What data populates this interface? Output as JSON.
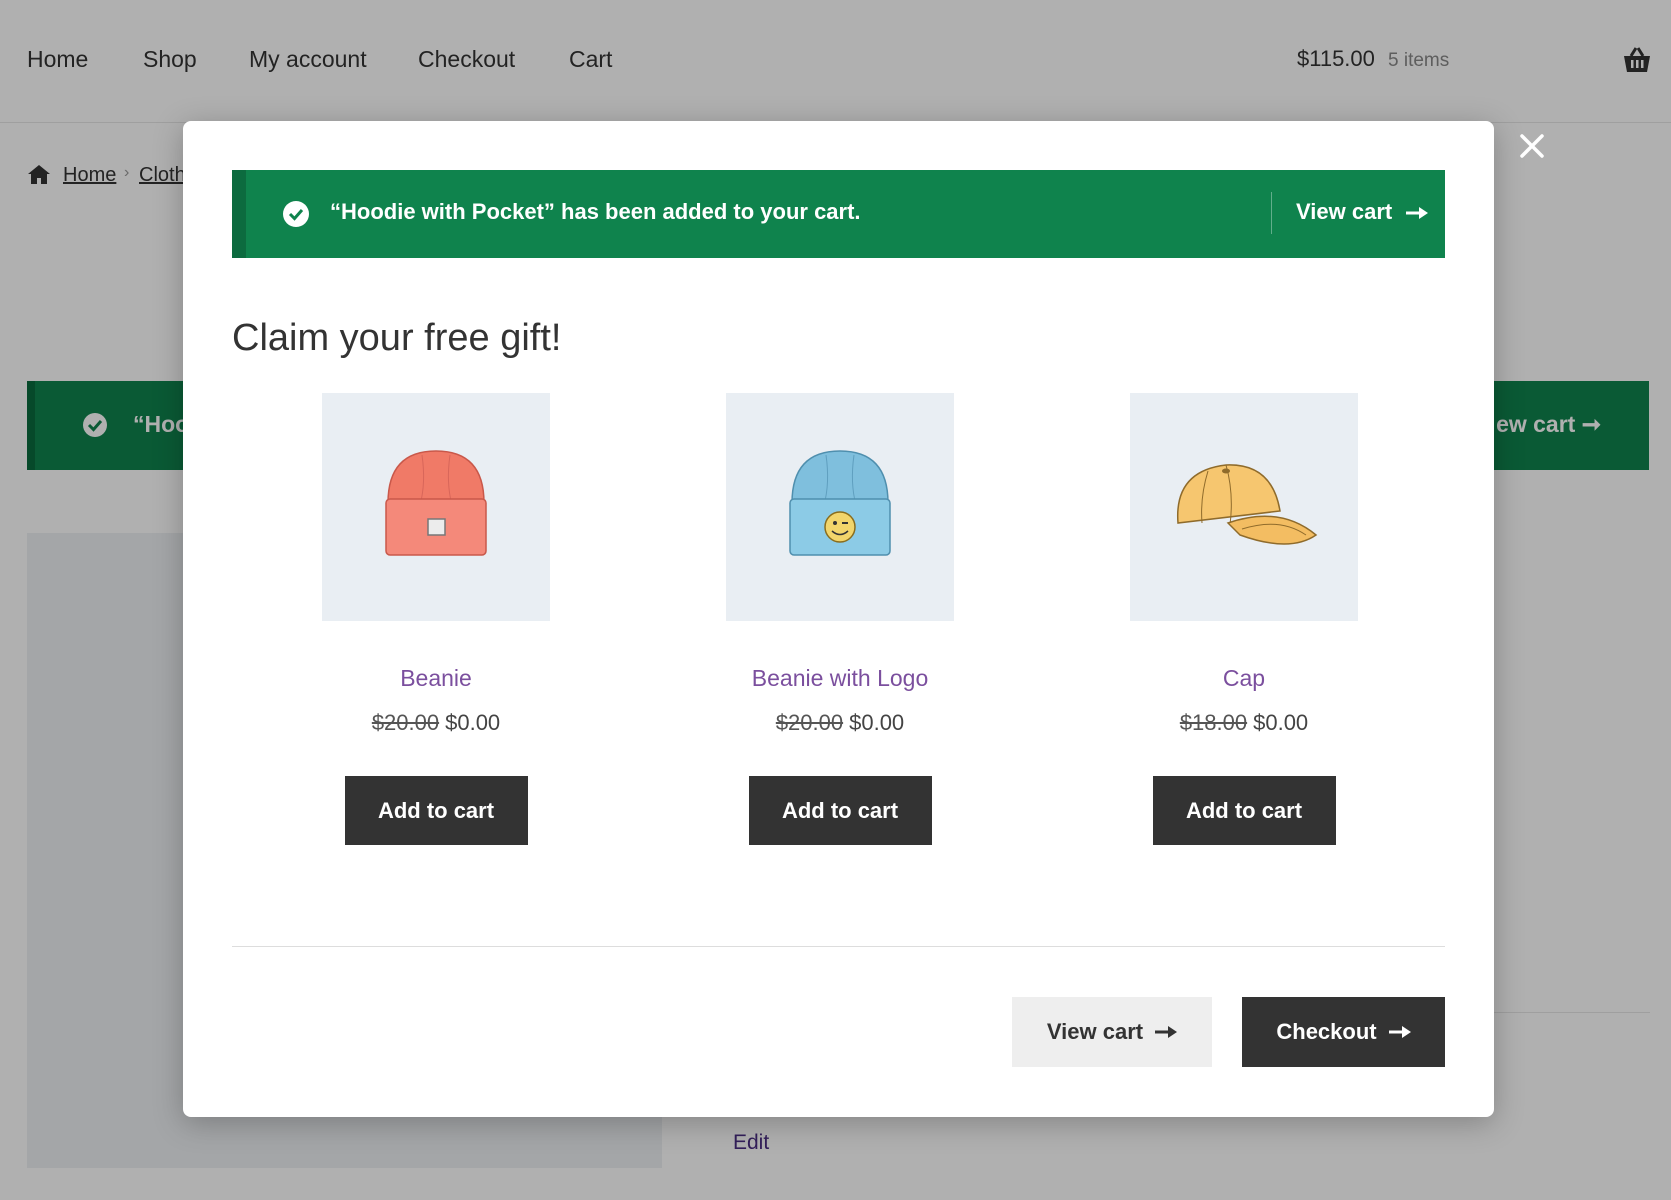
{
  "nav": {
    "items": [
      "Home",
      "Shop",
      "My account",
      "Checkout",
      "Cart"
    ],
    "cart_total": "$115.00",
    "cart_count": "5 items"
  },
  "breadcrumb": {
    "home": "Home",
    "current": "Cloth"
  },
  "background_notice": {
    "text": "“Hoo",
    "view_cart": "ew cart"
  },
  "background": {
    "edit_link": "Edit"
  },
  "modal": {
    "notice_text": "“Hoodie with Pocket” has been added to your cart.",
    "notice_view_cart": "View cart",
    "title": "Claim your free gift!",
    "products": [
      {
        "name": "Beanie",
        "old_price": "$20.00",
        "price": "$0.00",
        "button": "Add to cart",
        "image_icon": "red-beanie-icon"
      },
      {
        "name": "Beanie with Logo",
        "old_price": "$20.00",
        "price": "$0.00",
        "button": "Add to cart",
        "image_icon": "blue-beanie-logo-icon"
      },
      {
        "name": "Cap",
        "old_price": "$18.00",
        "price": "$0.00",
        "button": "Add to cart",
        "image_icon": "yellow-cap-icon"
      }
    ],
    "view_cart_button": "View cart",
    "checkout_button": "Checkout"
  },
  "colors": {
    "notice_green": "#0f834d",
    "button_dark": "#333333",
    "product_link": "#7b4f9e",
    "image_bg": "#e9eef3"
  }
}
